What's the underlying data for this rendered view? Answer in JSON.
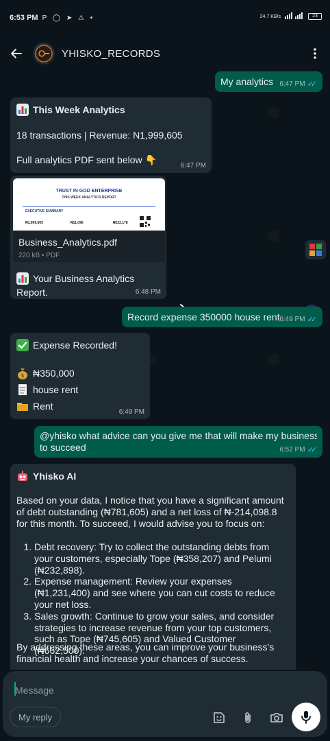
{
  "status_bar": {
    "time": "6:53 PM",
    "app_icons": "P ◯ ➤ ⚠ •",
    "network": "24.7 KB/s",
    "battery": "23"
  },
  "header": {
    "title": "YHISKO_RECORDS"
  },
  "messages": {
    "m1": {
      "text": "My analytics",
      "time": "6:47 PM",
      "ticks": "✓✓"
    },
    "m2": {
      "title": "This Week Analytics",
      "line1": "18 transactions | Revenue: N1,999,605",
      "line2": "Full analytics PDF sent below",
      "pointer": "👇",
      "time": "6:47 PM"
    },
    "m3": {
      "pdf": {
        "company": "TRUST IN GOD ENTERPRISE",
        "sub": "THIS WEEK ANALYTICS REPORT",
        "section": "EXECUTIVE SUMMARY",
        "stats": [
          "₦1,999,605",
          "₦11,096",
          "₦222,178"
        ]
      },
      "file_name": "Business_Analytics.pdf",
      "file_meta": "220 kB • PDF",
      "caption_line1": "Your Business Analytics",
      "caption_line2": "Report.",
      "time": "6:48 PM"
    },
    "m4": {
      "text": "Record expense 350000 house rent",
      "time": "6:49 PM",
      "ticks": "✓✓"
    },
    "m5": {
      "title": "Expense Recorded!",
      "amount": "₦350,000",
      "desc": "house rent",
      "category": "Rent",
      "time": "6:49 PM"
    },
    "m6": {
      "line1": "@yhisko what advice can you give me that will make my business",
      "line2": "to succeed",
      "time": "6:52 PM",
      "ticks": "✓✓"
    },
    "m7": {
      "title": "Yhisko AI",
      "intro": "Based on your data, I notice that you have a significant amount of debt outstanding (₦781,605) and a net loss of ₦-214,098.8 for this month. To succeed, I would advise you to focus on:",
      "items": [
        "Debt recovery: Try to collect the outstanding debts from your customers, especially Tope (₦358,207) and Pelumi (₦232,898).",
        "Expense management: Review your expenses (₦1,231,400) and see where you can cut costs to reduce your net loss.",
        "Sales growth: Continue to grow your sales, and consider strategies to increase revenue from your top customers, such as Tope (₦745,605) and Valued Customer (₦662,500)."
      ],
      "outro": "By addressing these areas, you can improve your business's financial health and increase your chances of success."
    }
  },
  "composer": {
    "placeholder": "Message",
    "reply_chip": "My reply"
  },
  "colors": {
    "background": "#0b141a",
    "incoming": "#202c33",
    "outgoing": "#005c4b",
    "read_ticks": "#53bdeb"
  }
}
